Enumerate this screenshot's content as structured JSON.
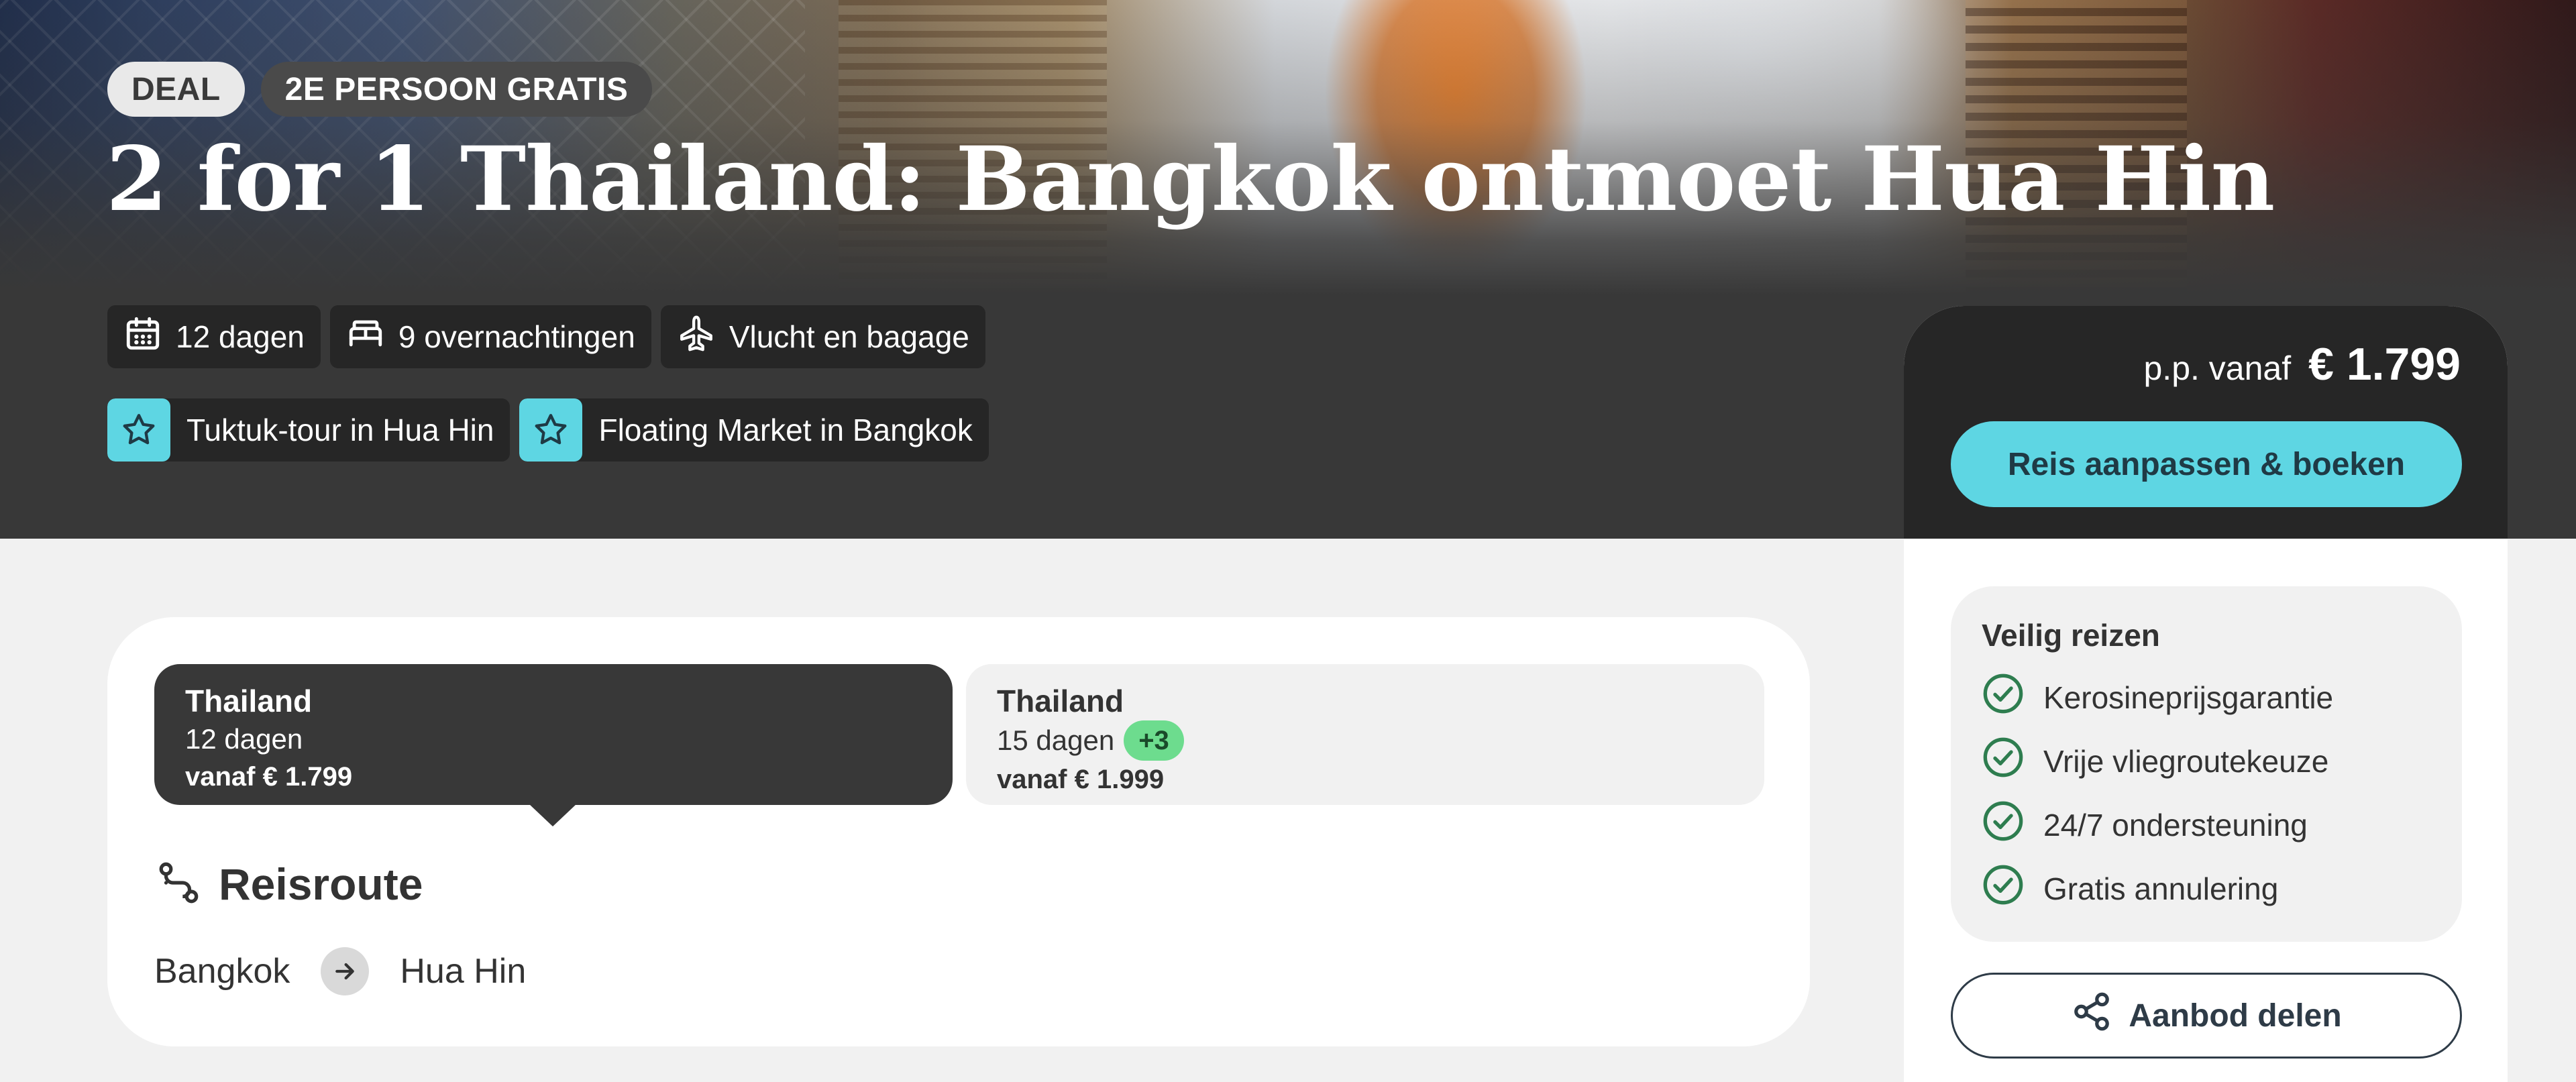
{
  "hero": {
    "badges": {
      "deal": "DEAL",
      "promo": "2E PERSOON GRATIS"
    },
    "title": "2 for 1 Thailand: Bangkok ontmoet Hua Hin",
    "features": [
      {
        "icon": "calendar-icon",
        "label": "12 dagen"
      },
      {
        "icon": "bed-icon",
        "label": "9 overnachtingen"
      },
      {
        "icon": "plane-icon",
        "label": "Vlucht en bagage"
      }
    ],
    "highlights": [
      {
        "icon": "star-icon",
        "label": "Tuktuk-tour in Hua Hin"
      },
      {
        "icon": "star-icon",
        "label": "Floating Market in Bangkok"
      }
    ]
  },
  "booking": {
    "price_prefix": "p.p. vanaf",
    "price": "€ 1.799",
    "book_label": "Reis aanpassen & boeken",
    "accent_color": "#5ed6e3"
  },
  "safety": {
    "title": "Veilig reizen",
    "items": [
      "Kerosineprijsgarantie",
      "Vrije vliegroutekeuze",
      "24/7 ondersteuning",
      "Gratis annulering"
    ],
    "check_color": "#2e7d4f"
  },
  "share": {
    "label": "Aanbod delen"
  },
  "options": [
    {
      "name": "Thailand",
      "days": "12 dagen",
      "price": "vanaf € 1.799",
      "selected": true
    },
    {
      "name": "Thailand",
      "days": "15 dagen",
      "extra": "+3",
      "price": "vanaf € 1.999",
      "selected": false
    }
  ],
  "route": {
    "title": "Reisroute",
    "stops": [
      "Bangkok",
      "Hua Hin"
    ]
  }
}
